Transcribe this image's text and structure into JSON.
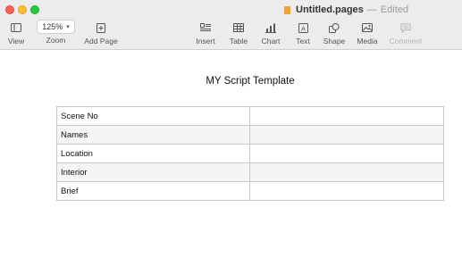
{
  "window": {
    "title": "Untitled.pages",
    "separator": "—",
    "status": "Edited"
  },
  "toolbar": {
    "view": "View",
    "zoom_value": "125%",
    "zoom": "Zoom",
    "add_page": "Add Page",
    "insert": "Insert",
    "table": "Table",
    "chart": "Chart",
    "text": "Text",
    "shape": "Shape",
    "media": "Media",
    "comment": "Comment"
  },
  "document": {
    "title": "MY Script Template",
    "rows": [
      {
        "label": "Scene No",
        "value": ""
      },
      {
        "label": "Names",
        "value": ""
      },
      {
        "label": "Location",
        "value": ""
      },
      {
        "label": "Interior",
        "value": ""
      },
      {
        "label": "Brief",
        "value": ""
      }
    ]
  },
  "colors": {
    "close": "#fe5f57",
    "minimize": "#febc2e",
    "maximize": "#28c840",
    "doc_icon": "#f0a23a"
  }
}
